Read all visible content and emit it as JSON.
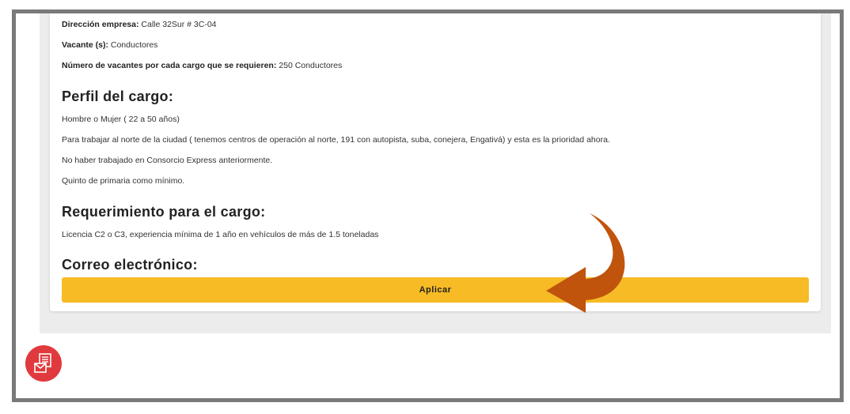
{
  "job": {
    "address_label": "Dirección empresa:",
    "address_value": "Calle 32Sur # 3C-04",
    "vacancy_label": "Vacante (s):",
    "vacancy_value": "Conductores",
    "count_label": "Número de vacantes por cada cargo que se requieren:",
    "count_value": "250 Conductores"
  },
  "profile": {
    "heading": "Perfil del cargo:",
    "lines": [
      "Hombre o Mujer ( 22 a 50 años)",
      "Para trabajar al norte de la ciudad ( tenemos centros de operación al norte, 191 con autopista, suba, conejera, Engativá) y esta es la prioridad ahora.",
      "No haber trabajado en Consorcio Express anteriormente.",
      "Quinto de primaria como mínimo."
    ]
  },
  "requirements": {
    "heading": "Requerimiento para el cargo:",
    "text": "Licencia C2 o C3, experiencia mínima de 1 año en vehículos de más de 1.5 toneladas"
  },
  "email": {
    "heading": "Correo electrónico:"
  },
  "apply_button": {
    "label": "Aplicar",
    "color": "#f6bb25"
  },
  "annotation": {
    "arrow_color": "#c0540c"
  },
  "fab": {
    "icon": "newsletter-mail-icon",
    "color": "#e03a3e"
  }
}
